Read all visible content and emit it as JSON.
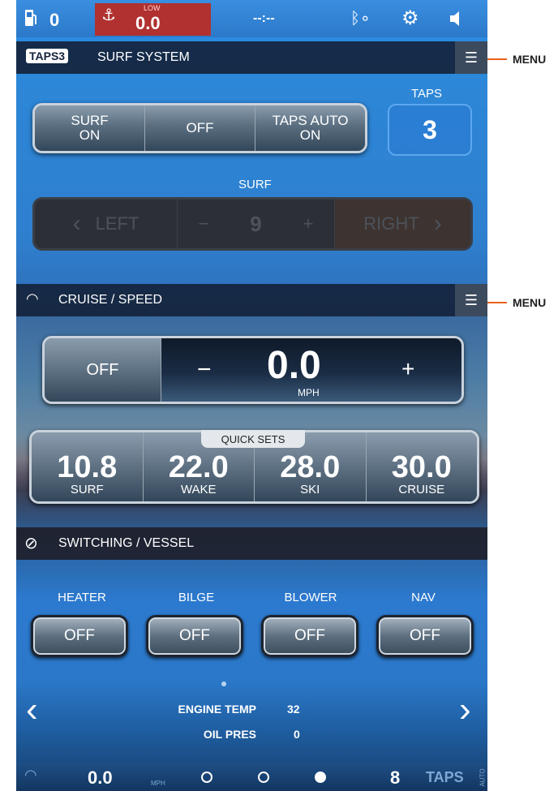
{
  "status_bar": {
    "fuel_value": "0",
    "depth_label": "LOW",
    "depth_value": "0.0",
    "time_value": "--:--",
    "icons": [
      "fuel-icon",
      "anchor-icon",
      "bluetooth-icon",
      "gear-icon",
      "speaker-icon"
    ]
  },
  "surf_system": {
    "logo": "TAPS3",
    "title": "SURF SYSTEM",
    "modes": [
      {
        "line1": "SURF",
        "line2": "ON"
      },
      {
        "line1": "",
        "line2": "OFF"
      },
      {
        "line1": "TAPS AUTO",
        "line2": "ON"
      }
    ],
    "taps_label": "TAPS",
    "taps_value": "3",
    "surf_label": "SURF",
    "surf_left": "LEFT",
    "surf_minus": "−",
    "surf_value": "9",
    "surf_plus": "+",
    "surf_right": "RIGHT"
  },
  "cruise_speed": {
    "title": "CRUISE / SPEED",
    "off_label": "OFF",
    "minus": "−",
    "speed": "0.0",
    "plus": "+",
    "unit": "MPH",
    "quick_sets_label": "QUICK SETS",
    "quick_sets": [
      {
        "value": "10.8",
        "label": "SURF"
      },
      {
        "value": "22.0",
        "label": "WAKE"
      },
      {
        "value": "28.0",
        "label": "SKI"
      },
      {
        "value": "30.0",
        "label": "CRUISE"
      }
    ]
  },
  "switching": {
    "title": "SWITCHING / VESSEL",
    "switches": [
      {
        "label": "HEATER",
        "state": "OFF"
      },
      {
        "label": "BILGE",
        "state": "OFF"
      },
      {
        "label": "BLOWER",
        "state": "OFF"
      },
      {
        "label": "NAV",
        "state": "OFF"
      }
    ]
  },
  "gauges": {
    "rows": [
      {
        "label": "ENGINE TEMP",
        "value": "32"
      },
      {
        "label": "OIL PRES",
        "value": "0"
      }
    ],
    "prev": "‹",
    "next": "›"
  },
  "bottom_bar": {
    "speed": "0.0",
    "unit": "MPH",
    "taps_value": "8",
    "taps_label": "TAPS",
    "auto_label": "AUTO"
  },
  "callouts": {
    "menu1": "MENU",
    "menu2": "MENU"
  },
  "colors": {
    "accent_orange": "#e8601c",
    "depth_alarm": "#b0312f",
    "header_bar": "#14233c"
  }
}
